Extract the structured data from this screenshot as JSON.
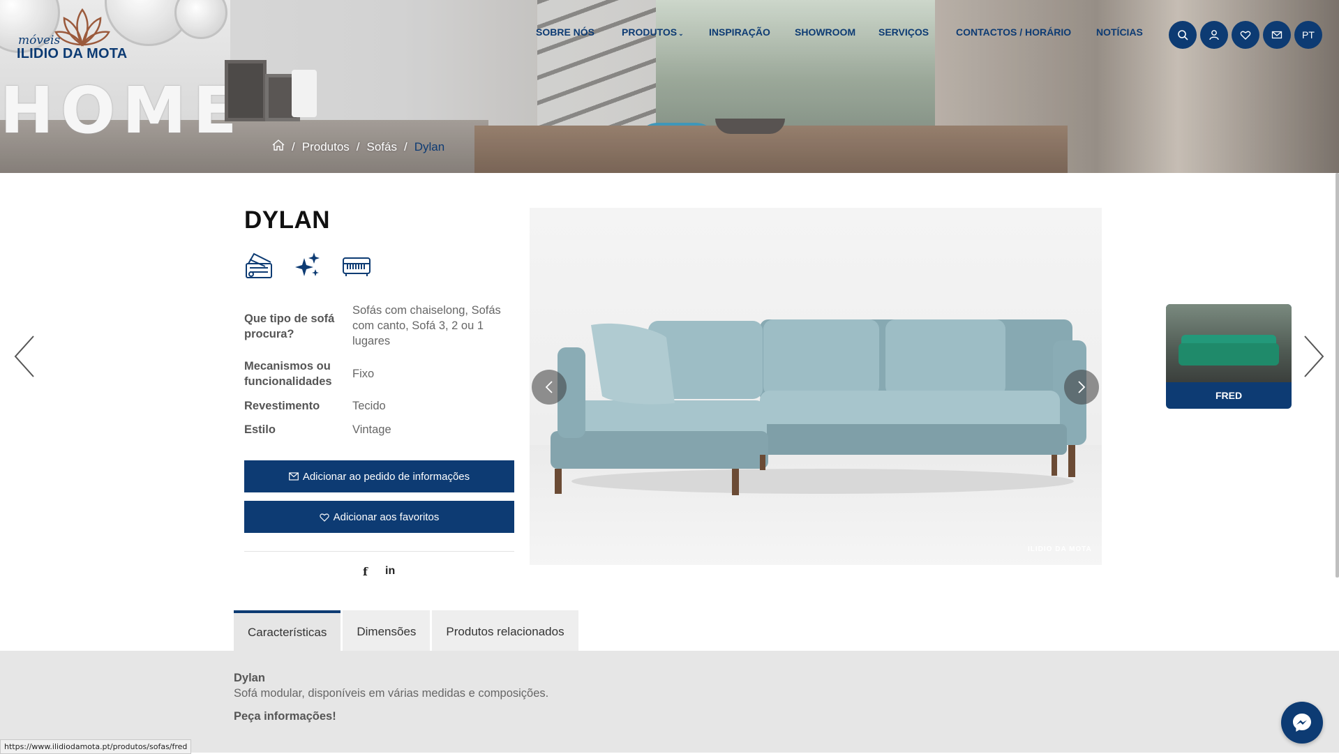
{
  "logo": {
    "top_word": "móveis",
    "brand": "ILIDIO DA MOTA"
  },
  "hero": {
    "word": "HOME"
  },
  "nav": {
    "items": [
      {
        "label": "SOBRE NÓS"
      },
      {
        "label": "PRODUTOS",
        "has_dropdown": true
      },
      {
        "label": "INSPIRAÇÃO"
      },
      {
        "label": "SHOWROOM"
      },
      {
        "label": "SERVIÇOS"
      },
      {
        "label": "CONTACTOS / HORÁRIO"
      },
      {
        "label": "NOTÍCIAS"
      }
    ],
    "dropdown_caret": "⌄",
    "icons": [
      "search-icon",
      "user-icon",
      "heart-icon",
      "mail-icon"
    ],
    "language": "PT"
  },
  "breadcrumb": {
    "home_icon": "home-icon",
    "items": [
      "Produtos",
      "Sofás",
      "Dylan"
    ],
    "separator": "/"
  },
  "product": {
    "title": "DYLAN",
    "feature_icons": [
      "fabric-samples-icon",
      "sparkles-icon",
      "sofa-bed-icon"
    ],
    "attributes": [
      {
        "label": "Que tipo de sofá procura?",
        "value": "Sofás com chaiselong, Sofás com canto, Sofá 3, 2 ou 1 lugares"
      },
      {
        "label": "Mecanismos ou funcionalidades",
        "value": "Fixo"
      },
      {
        "label": "Revestimento",
        "value": "Tecido"
      },
      {
        "label": "Estilo",
        "value": "Vintage"
      }
    ],
    "btn_request": "Adicionar ao pedido de informações",
    "btn_favorites": "Adicionar aos favoritos",
    "share": {
      "facebook": "f",
      "linkedin": "in"
    },
    "image_watermark": "ILIDIO DA MOTA"
  },
  "next_product": {
    "label": "FRED"
  },
  "tabs": [
    {
      "label": "Características",
      "active": true
    },
    {
      "label": "Dimensões",
      "active": false
    },
    {
      "label": "Produtos relacionados",
      "active": false
    }
  ],
  "description": {
    "title": "Dylan",
    "text": "Sofá modular, disponíveis em várias medidas e composições.",
    "cta": "Peça informações!"
  },
  "statusbar": {
    "url": "https://www.ilidiodamota.pt/produtos/sofas/fred"
  },
  "colors": {
    "primary": "#0d3b73",
    "sofa": "#8fb0b8"
  }
}
